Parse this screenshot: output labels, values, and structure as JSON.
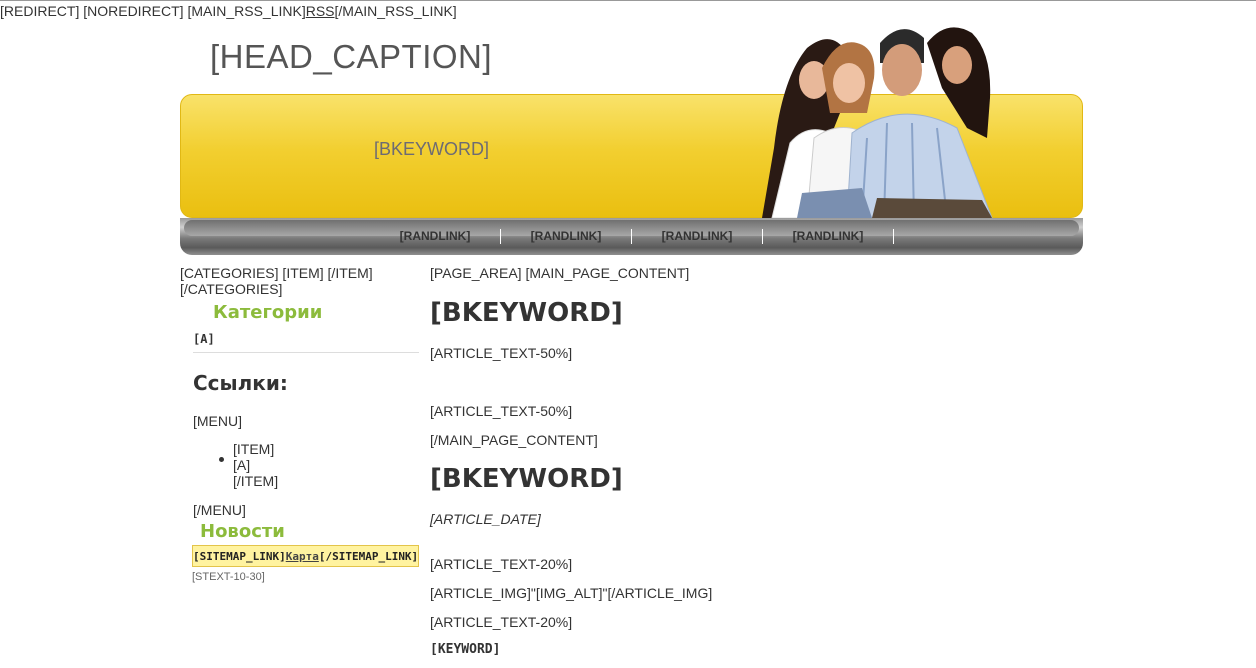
{
  "top": {
    "prefix": "[REDIRECT] [NOREDIRECT] [MAIN_RSS_LINK]",
    "rss": "RSS",
    "suffix": "[/MAIN_RSS_LINK]"
  },
  "header": {
    "caption": "[HEAD_CAPTION]",
    "banner_keyword": "[BKEYWORD]"
  },
  "nav": {
    "links": [
      "[RANDLINK]",
      "[RANDLINK]",
      "[RANDLINK]",
      "[RANDLINK]"
    ]
  },
  "sidebar": {
    "categories_line1": "[CATEGORIES] [ITEM] [/ITEM]",
    "categories_line2": "[/CATEGORIES]",
    "categories_title": "Категории",
    "category_a": "[A]",
    "links_title": "Ссылки:",
    "menu_open": "[MENU]",
    "menu_item_open": "[ITEM]",
    "menu_item_a": "[A]",
    "menu_item_close": "[/ITEM]",
    "menu_close": "[/MENU]",
    "news_title": "Новости",
    "sitemap_prefix": "[SITEMAP_LINK]",
    "sitemap_link": "Карта",
    "sitemap_suffix": "[/SITEMAP_LINK]",
    "stext": "[STEXT-10-30]"
  },
  "content": {
    "page_tags": "[PAGE_AREA] [MAIN_PAGE_CONTENT]",
    "heading1": "[BKEYWORD]",
    "article_text_50a": "[ARTICLE_TEXT-50%]",
    "article_text_50b": "[ARTICLE_TEXT-50%]",
    "main_content_close": "[/MAIN_PAGE_CONTENT]",
    "heading2": "[BKEYWORD]",
    "article_date": "[ARTICLE_DATE]",
    "article_text_20a": "[ARTICLE_TEXT-20%]",
    "article_img": "[ARTICLE_IMG]\"[IMG_ALT]\"[/ARTICLE_IMG]",
    "article_text_20b": "[ARTICLE_TEXT-20%]",
    "keyword": "[KEYWORD]"
  }
}
